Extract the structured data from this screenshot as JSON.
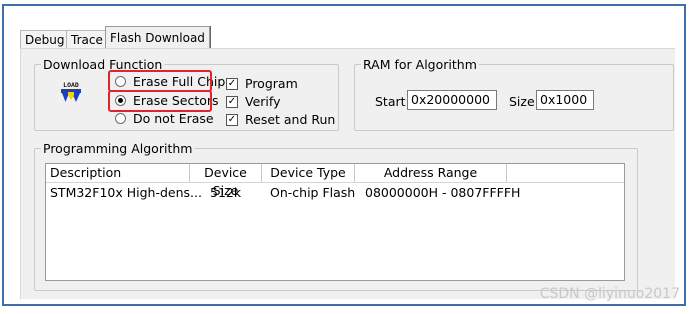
{
  "tabs": [
    "Debug",
    "Trace",
    "Flash Download"
  ],
  "download_function": {
    "title": "Download Function",
    "icon_label": "LOAD",
    "erase_options": [
      {
        "label": "Erase Full Chip",
        "selected": false
      },
      {
        "label": "Erase Sectors",
        "selected": true
      },
      {
        "label": "Do not Erase",
        "selected": false
      }
    ],
    "checks": [
      {
        "label": "Program",
        "checked": true
      },
      {
        "label": "Verify",
        "checked": true
      },
      {
        "label": "Reset and Run",
        "checked": true
      }
    ]
  },
  "ram": {
    "title": "RAM for Algorithm",
    "start_label": "Start:",
    "start_value": "0x20000000",
    "size_label": "Size:",
    "size_value": "0x1000"
  },
  "programming_algorithm": {
    "title": "Programming Algorithm",
    "columns": [
      "Description",
      "Device Size",
      "Device Type",
      "Address Range"
    ],
    "rows": [
      [
        "STM32F10x High-dens...",
        "512k",
        "On-chip Flash",
        "08000000H - 0807FFFFH"
      ]
    ]
  },
  "watermark": "CSDN @liyinuo2017",
  "colors": {
    "frame": "#3f6ea8",
    "highlight": "#e0242a",
    "icon_blue": "#1d3fbf",
    "icon_yellow": "#f5d400"
  }
}
